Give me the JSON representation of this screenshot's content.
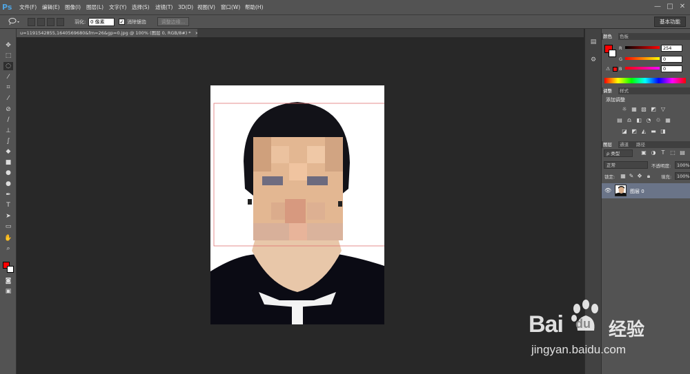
{
  "app": {
    "logo": "Ps"
  },
  "menu": [
    "文件(F)",
    "编辑(E)",
    "图像(I)",
    "图层(L)",
    "文字(Y)",
    "选择(S)",
    "滤镜(T)",
    "3D(D)",
    "视图(V)",
    "窗口(W)",
    "帮助(H)"
  ],
  "window_controls": {
    "minimize": "—",
    "maximize": "□",
    "close": "✕"
  },
  "options": {
    "feather_label": "羽化:",
    "feather_value": "0 像素",
    "antialias_label": "消除锯齿",
    "antialias_check": "✓",
    "refine_label": "调整边缘...",
    "workspace": "基本功能"
  },
  "document": {
    "tab_title": "u=1191542855,1640569680&fm=26&gp=0.jpg @ 100% (图层 0, RGB/8#) *",
    "tab_close": "×"
  },
  "panels": {
    "color": {
      "tabs": [
        "颜色",
        "色板"
      ],
      "labels": [
        "R",
        "G",
        "B"
      ],
      "values": [
        "254",
        "0",
        "0"
      ],
      "foreground": "#fe0000",
      "background": "#ffffff"
    },
    "adjustments": {
      "tabs": [
        "调整",
        "样式"
      ],
      "heading": "添加调整"
    },
    "layers": {
      "tabs": [
        "图层",
        "通道",
        "路径"
      ],
      "filter_label": "ρ 类型",
      "blend_mode": "正常",
      "opacity_label": "不透明度:",
      "opacity_value": "100%",
      "lock_label": "锁定:",
      "fill_label": "填充:",
      "fill_value": "100%",
      "layer_name": "图层 0"
    }
  },
  "watermark": {
    "brand": "Bai",
    "brand2": "du",
    "cn": "经验",
    "url": "jingyan.baidu.com"
  }
}
